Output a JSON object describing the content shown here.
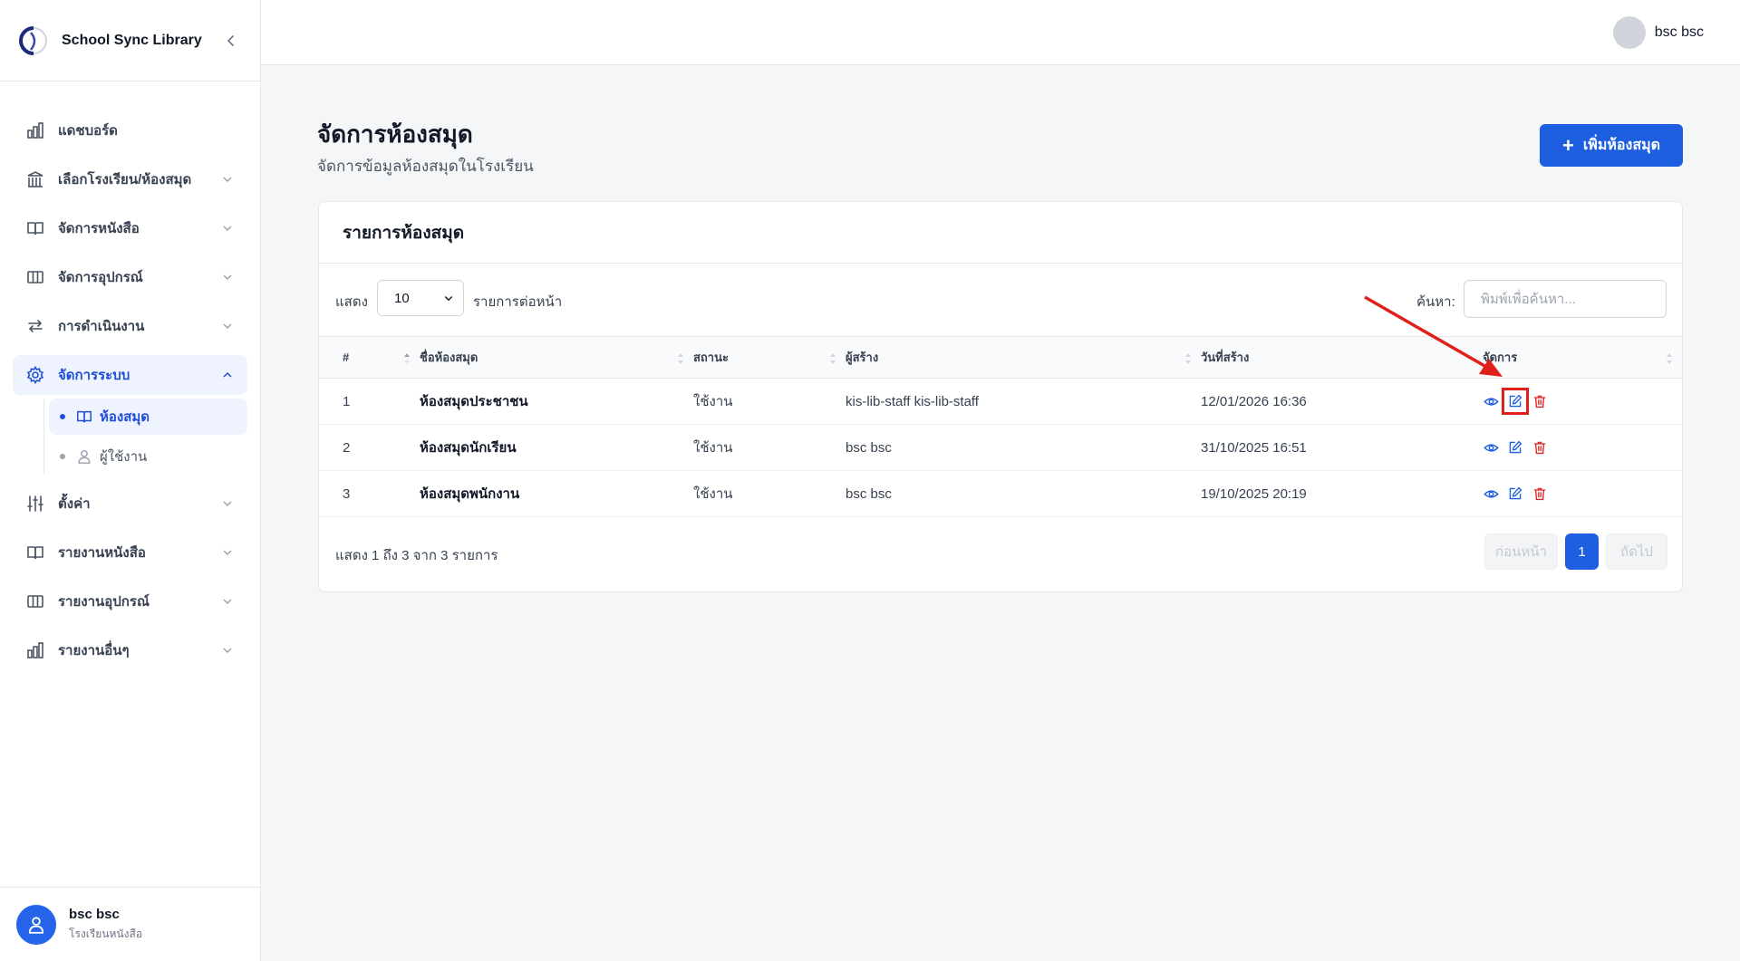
{
  "app": {
    "name": "School Sync Library"
  },
  "sidebar": {
    "items": [
      {
        "label": "แดชบอร์ด",
        "icon": "bar-chart-icon"
      },
      {
        "label": "เลือกโรงเรียน/ห้องสมุด",
        "icon": "building-icon"
      },
      {
        "label": "จัดการหนังสือ",
        "icon": "book-icon"
      },
      {
        "label": "จัดการอุปกรณ์",
        "icon": "columns-icon"
      },
      {
        "label": "การดำเนินงาน",
        "icon": "swap-arrows-icon"
      },
      {
        "label": "จัดการระบบ",
        "icon": "gear-icon"
      },
      {
        "label": "ตั้งค่า",
        "icon": "sliders-icon"
      },
      {
        "label": "รายงานหนังสือ",
        "icon": "book-icon"
      },
      {
        "label": "รายงานอุปกรณ์",
        "icon": "columns-icon"
      },
      {
        "label": "รายงานอื่นๆ",
        "icon": "bar-chart-icon"
      }
    ],
    "sub_items": [
      {
        "label": "ห้องสมุด",
        "icon": "book-icon"
      },
      {
        "label": "ผู้ใช้งาน",
        "icon": "user-icon"
      }
    ],
    "user": {
      "name": "bsc bsc",
      "school": "โรงเรียนหนังสือ"
    }
  },
  "topbar": {
    "user_name": "bsc bsc"
  },
  "page": {
    "title": "จัดการห้องสมุด",
    "subtitle": "จัดการข้อมูลห้องสมุดในโรงเรียน",
    "add_button": "เพิ่มห้องสมุด"
  },
  "card": {
    "title": "รายการห้องสมุด",
    "show_label": "แสดง",
    "page_size": "10",
    "per_page_label": "รายการต่อหน้า",
    "search_label": "ค้นหา:",
    "search_placeholder": "พิมพ์เพื่อค้นหา...",
    "columns": [
      "#",
      "ชื่อห้องสมุด",
      "สถานะ",
      "ผู้สร้าง",
      "วันที่สร้าง",
      "จัดการ"
    ],
    "rows": [
      {
        "num": "1",
        "name": "ห้องสมุดประชาชน",
        "status": "ใช้งาน",
        "creator": "kis-lib-staff kis-lib-staff",
        "date": "12/01/2026 16:36"
      },
      {
        "num": "2",
        "name": "ห้องสมุดนักเรียน",
        "status": "ใช้งาน",
        "creator": "bsc bsc",
        "date": "31/10/2025 16:51"
      },
      {
        "num": "3",
        "name": "ห้องสมุดพนักงาน",
        "status": "ใช้งาน",
        "creator": "bsc bsc",
        "date": "19/10/2025 20:19"
      }
    ],
    "footer_info": "แสดง 1 ถึง 3 จาก 3 รายการ",
    "pager": {
      "prev": "ก่อนหน้า",
      "current": "1",
      "next": "ถัดไป"
    }
  },
  "colors": {
    "accent": "#1d5fe0",
    "delete": "#dc2626",
    "annotation": "#e0201b"
  }
}
